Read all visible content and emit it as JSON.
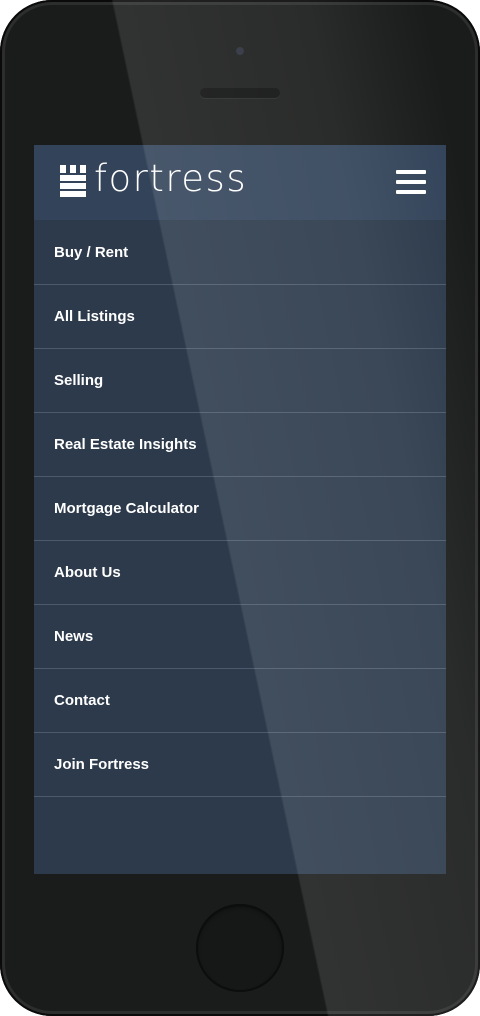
{
  "brand": {
    "name": "fortress",
    "logo_icon": "fortress-tower-icon"
  },
  "header": {
    "menu_icon": "hamburger-menu-icon"
  },
  "nav": {
    "items": [
      {
        "label": "Buy / Rent"
      },
      {
        "label": "All Listings"
      },
      {
        "label": "Selling"
      },
      {
        "label": "Real Estate Insights"
      },
      {
        "label": "Mortgage Calculator"
      },
      {
        "label": "About Us"
      },
      {
        "label": "News"
      },
      {
        "label": "Contact"
      },
      {
        "label": "Join Fortress"
      }
    ]
  },
  "colors": {
    "header_bg": "#33445a",
    "menu_bg": "#2c3a4b",
    "divider": "#4b5a6c",
    "text": "#ffffff",
    "device_body": "#1a1c1b"
  }
}
